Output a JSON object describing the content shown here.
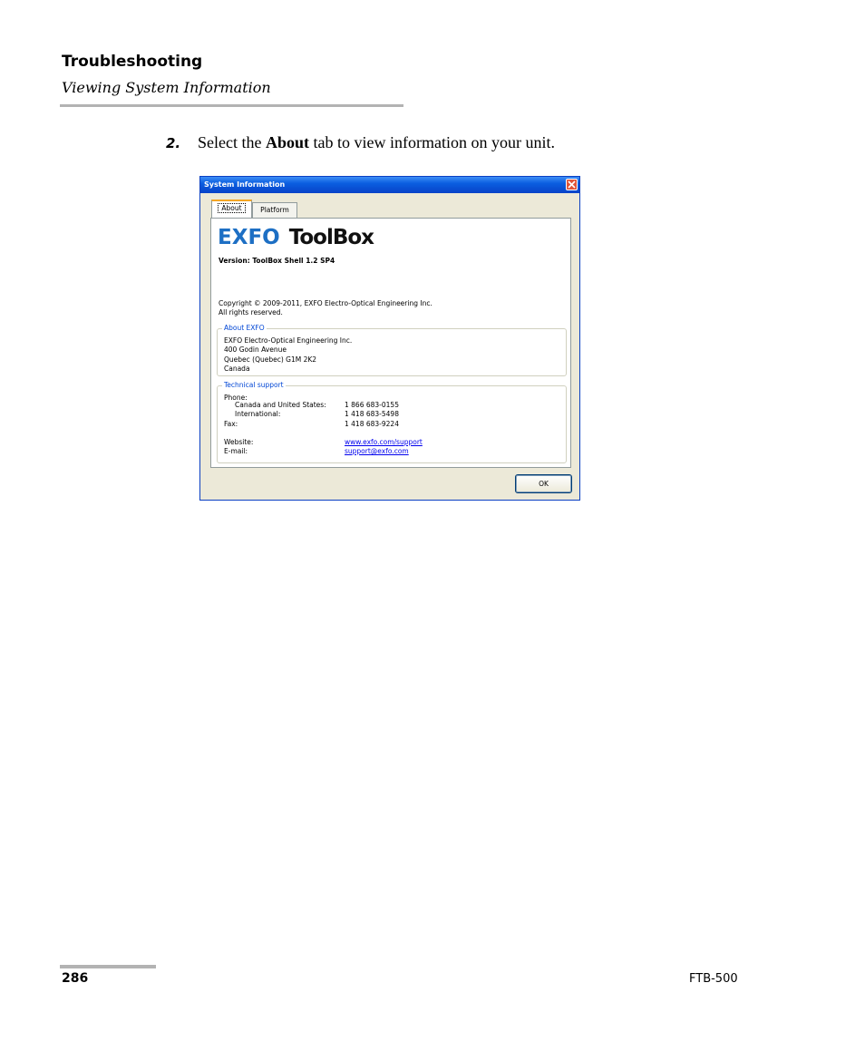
{
  "header": {
    "title": "Troubleshooting",
    "subtitle": "Viewing System Information"
  },
  "step": {
    "number": "2.",
    "text_before": "Select the ",
    "text_bold": "About",
    "text_after": " tab to view information on your unit."
  },
  "dialog": {
    "title": "System Information",
    "tabs": [
      "About",
      "Platform"
    ],
    "active_tab": "About",
    "logo": {
      "brand": "EXFO",
      "product": "ToolBox",
      "brand_color": "#1d6fc4"
    },
    "version": "Version: ToolBox Shell 1.2 SP4",
    "copyright": [
      "Copyright © 2009-2011, EXFO Electro-Optical Engineering Inc.",
      "All rights reserved."
    ],
    "about_exfo": {
      "legend": "About EXFO",
      "lines": [
        "EXFO Electro-Optical Engineering Inc.",
        "400 Godin Avenue",
        "Quebec (Quebec) G1M 2K2",
        "Canada"
      ]
    },
    "support": {
      "legend": "Technical support",
      "phone_label": "Phone:",
      "rows": [
        {
          "label": "Canada and United States:",
          "value": "1 866 683-0155"
        },
        {
          "label": "International:",
          "value": "1 418 683-5498"
        },
        {
          "label": "Fax:",
          "value": "1 418 683-9224"
        }
      ],
      "website_label": "Website:",
      "website": "www.exfo.com/support",
      "email_label": "E-mail:",
      "email": "support@exfo.com"
    },
    "ok_label": "OK",
    "accent_color": "#0046d5"
  },
  "footer": {
    "page_number": "286",
    "product": "FTB-500"
  }
}
